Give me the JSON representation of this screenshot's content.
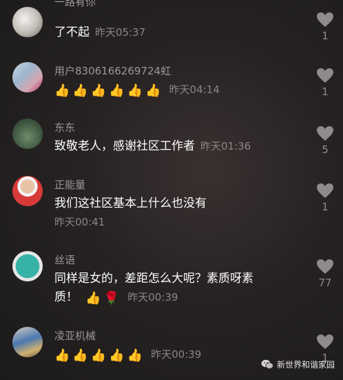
{
  "comments": [
    {
      "name": "一路有你",
      "text": "了不起",
      "time": "昨天05:37",
      "likes": "1",
      "emojis": []
    },
    {
      "name": "用户8306166269724虹",
      "text": "",
      "time": "昨天04:14",
      "likes": "1",
      "emojis": [
        "👍",
        "👍",
        "👍",
        "👍",
        "👍",
        "👍"
      ]
    },
    {
      "name": "东东",
      "text": "致敬老人，感谢社区工作者",
      "time": "昨天01:36",
      "likes": "5",
      "emojis": []
    },
    {
      "name": "正能量",
      "text": "我们这社区基本上什么也没有",
      "time": "昨天00:41",
      "likes": "1",
      "emojis": []
    },
    {
      "name": "丝语",
      "text": "同样是女的，差距怎么大呢？素质呀素",
      "text2": "质！",
      "time": "昨天00:39",
      "likes": "77",
      "emojis": [
        "👍",
        "🌹"
      ]
    },
    {
      "name": "凌亚机械",
      "text": "",
      "time": "昨天00:39",
      "likes": "1",
      "emojis": [
        "👍",
        "👍",
        "👍",
        "👍",
        "👍"
      ]
    }
  ],
  "watermark": "新世界和谐家园",
  "icons": {
    "like": "heart-icon",
    "watermark": "wechat-icon"
  }
}
